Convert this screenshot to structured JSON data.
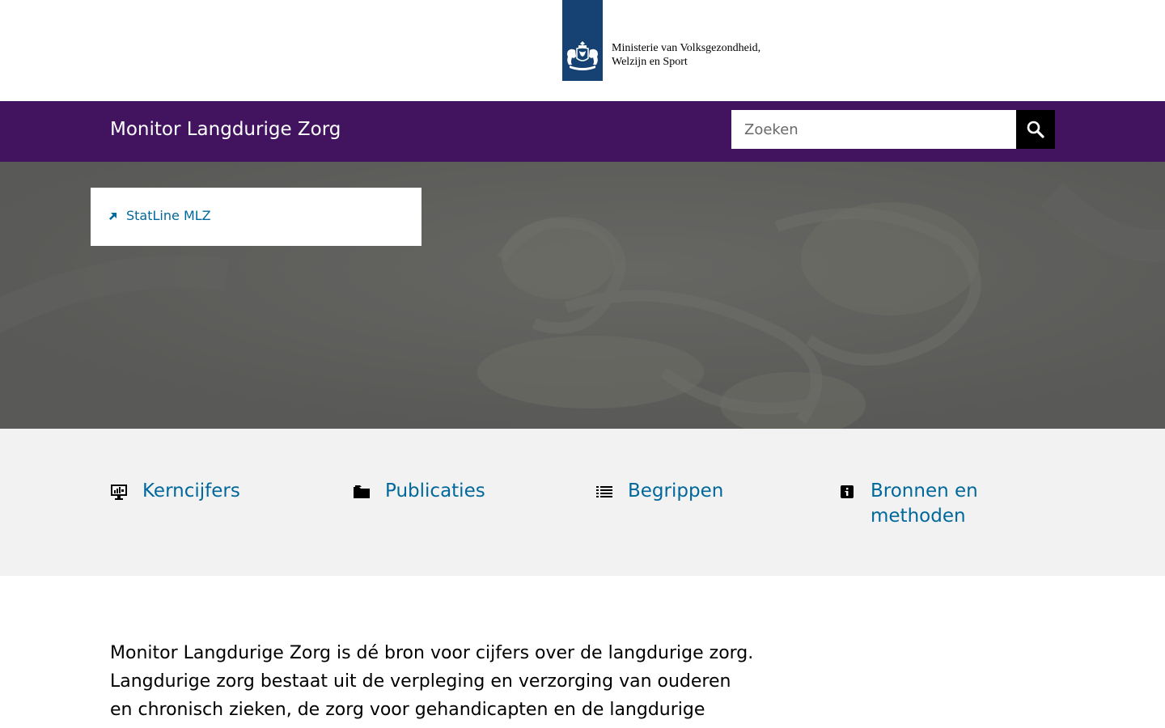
{
  "logo": {
    "line1": "Ministerie van Volksgezondheid,",
    "line2": "Welzijn en Sport",
    "icon": "rijksoverheid-emblem-icon",
    "ribbon_color": "#154273"
  },
  "header": {
    "site_title": "Monitor Langdurige Zorg",
    "bar_color": "#42145f",
    "search": {
      "placeholder": "Zoeken",
      "value": "",
      "button_icon": "search-icon"
    }
  },
  "hero": {
    "link_label": "StatLine MLZ",
    "link_icon": "arrow-up-right-icon"
  },
  "quick_links": [
    {
      "label": "Kerncijfers",
      "icon": "monitor-chart-icon"
    },
    {
      "label": "Publicaties",
      "icon": "folder-icon"
    },
    {
      "label": "Begrippen",
      "icon": "list-icon"
    },
    {
      "label": "Bronnen en methoden",
      "icon": "info-icon"
    }
  ],
  "intro": {
    "text": "Monitor Langdurige Zorg is dé bron voor cijfers over de langdurige zorg. Langdurige zorg bestaat uit de verpleging en verzorging van ouderen en chronisch zieken, de zorg voor gehandicapten en de langdurige"
  },
  "colors": {
    "link": "#01689b",
    "quick_bg": "#f2f2f2"
  }
}
